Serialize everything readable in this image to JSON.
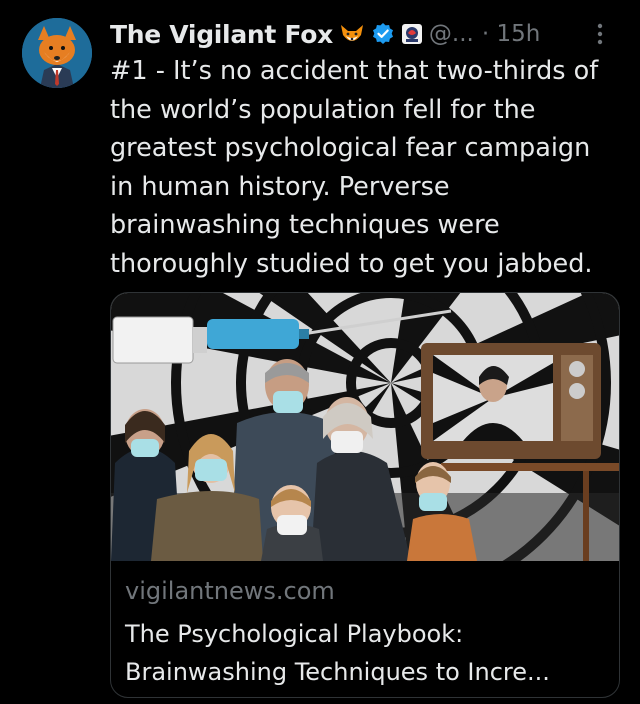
{
  "tweet": {
    "author_name": "The Vigilant Fox",
    "handle": "@...",
    "time": "· 15h",
    "text": "#1 - It’s no accident that two-thirds of the world’s population fell for the greatest psychological fear campaign in human history. Perverse brainwashing techniques were thoroughly studied to get you jabbed."
  },
  "icons": {
    "avatar": "fox-avatar",
    "emoji": "fox-emoji-icon",
    "verified": "verified-badge-icon",
    "affiliate": "affiliate-badge-icon",
    "more": "more-options-icon"
  },
  "card": {
    "domain": "vigilantnews.com",
    "title": "The Psychological Playbook: Brainwashing Techniques to Incre..."
  },
  "colors": {
    "background": "#000000",
    "text": "#e7e9ea",
    "secondary": "#71767b",
    "verified": "#1d9bf0"
  }
}
